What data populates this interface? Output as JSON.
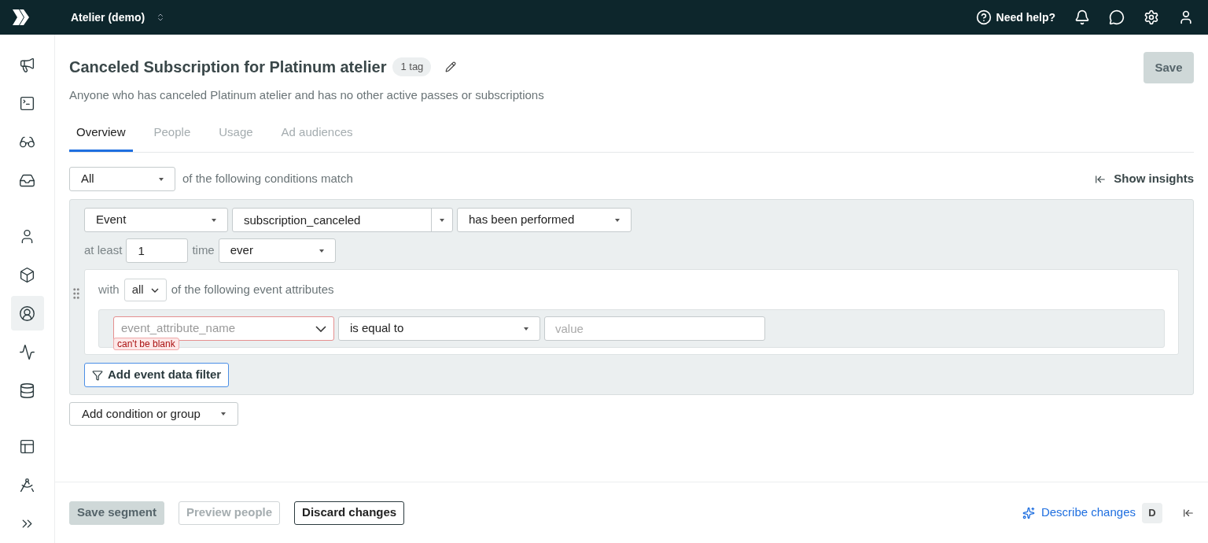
{
  "topbar": {
    "workspace": "Atelier (demo)",
    "help": "Need help?"
  },
  "sidebar": {
    "groups": [
      [
        {
          "selected": false
        },
        {
          "selected": false
        },
        {
          "selected": false
        },
        {
          "selected": false
        }
      ],
      [
        {
          "selected": false
        },
        {
          "selected": false
        },
        {
          "selected": true
        },
        {
          "selected": false
        },
        {
          "selected": false
        }
      ],
      [
        {
          "selected": false
        },
        {
          "selected": false
        },
        {
          "selected": false
        }
      ]
    ]
  },
  "header": {
    "title": "Canceled Subscription for Platinum atelier",
    "tag": "1 tag",
    "description": "Anyone who has canceled Platinum atelier and has no other active passes or subscriptions",
    "save": {
      "label": "Save",
      "disabled": true
    }
  },
  "tabs": [
    {
      "label": "Overview",
      "selected": true
    },
    {
      "label": "People",
      "selected": false
    },
    {
      "label": "Usage",
      "selected": false
    },
    {
      "label": "Ad audiences",
      "selected": false
    }
  ],
  "match": {
    "value": "All",
    "text": "of the following conditions match"
  },
  "show_insights": "Show insights",
  "condition": {
    "type": "Event",
    "event": "subscription_canceled",
    "operator": "has been performed",
    "at_least_label": "at least",
    "count": "1",
    "time_label": "time",
    "timeframe": "ever",
    "with_label": "with",
    "attr_match": "all",
    "attr_text": "of the following event attributes",
    "filter": {
      "attribute_placeholder": "event_attribute_name",
      "operator": "is equal to",
      "value_placeholder": "value",
      "error": "can't be blank"
    },
    "add_filter": "Add event data filter"
  },
  "add_condition": "Add condition or group",
  "footer": {
    "buttons": [
      {
        "label": "Save segment",
        "kind": "primary",
        "disabled": true
      },
      {
        "label": "Preview people",
        "kind": "secondary",
        "disabled": true
      },
      {
        "label": "Discard changes",
        "kind": "secondary",
        "disabled": false
      }
    ],
    "describe": "Describe changes",
    "shortcut": "D"
  }
}
